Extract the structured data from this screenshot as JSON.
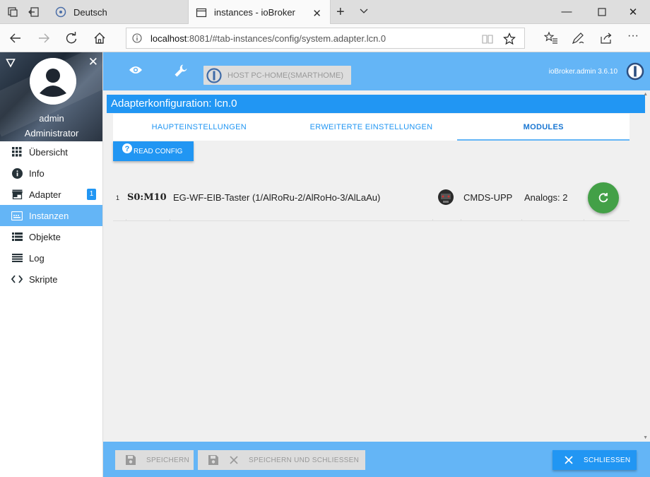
{
  "browser": {
    "tabs": [
      {
        "label": "Deutsch"
      },
      {
        "label": "instances - ioBroker"
      }
    ],
    "url_host": "localhost",
    "url_rest": ":8081/#tab-instances/config/system.adapter.lcn.0"
  },
  "sidebar": {
    "user_name": "admin",
    "user_role": "Administrator",
    "items": [
      {
        "label": "Übersicht",
        "icon": "grid-icon"
      },
      {
        "label": "Info",
        "icon": "info-icon"
      },
      {
        "label": "Adapter",
        "icon": "store-icon",
        "badge": "1"
      },
      {
        "label": "Instanzen",
        "icon": "instances-icon",
        "active": true
      },
      {
        "label": "Objekte",
        "icon": "list-icon"
      },
      {
        "label": "Log",
        "icon": "lines-icon"
      },
      {
        "label": "Skripte",
        "icon": "code-icon"
      }
    ]
  },
  "header": {
    "host_label": "HOST PC-HOME(SMARTHOME)",
    "version": "ioBroker.admin 3.6.10"
  },
  "config": {
    "title": "Adapterkonfiguration: lcn.0",
    "tabs": [
      {
        "label": "HAUPTEINSTELLUNGEN"
      },
      {
        "label": "ERWEITERTE EINSTELLUNGEN"
      },
      {
        "label": "MODULES",
        "active": true
      }
    ],
    "read_config_label": "READ CONFIG",
    "modules": [
      {
        "index": "1",
        "address": "S0:M10",
        "name": "EG-WF-EIB-Taster (1/AlRoRu-2/AlRoHo-3/AlLaAu)",
        "type": "CMDS-UPP",
        "analogs": "Analogs: 2"
      }
    ]
  },
  "footer": {
    "save_label": "SPEICHERN",
    "save_close_label": "SPEICHERN UND SCHLIESSEN",
    "close_label": "SCHLIESSEN"
  },
  "colors": {
    "primary": "#2196f3",
    "header": "#64b5f6",
    "refresh": "#43a047"
  }
}
